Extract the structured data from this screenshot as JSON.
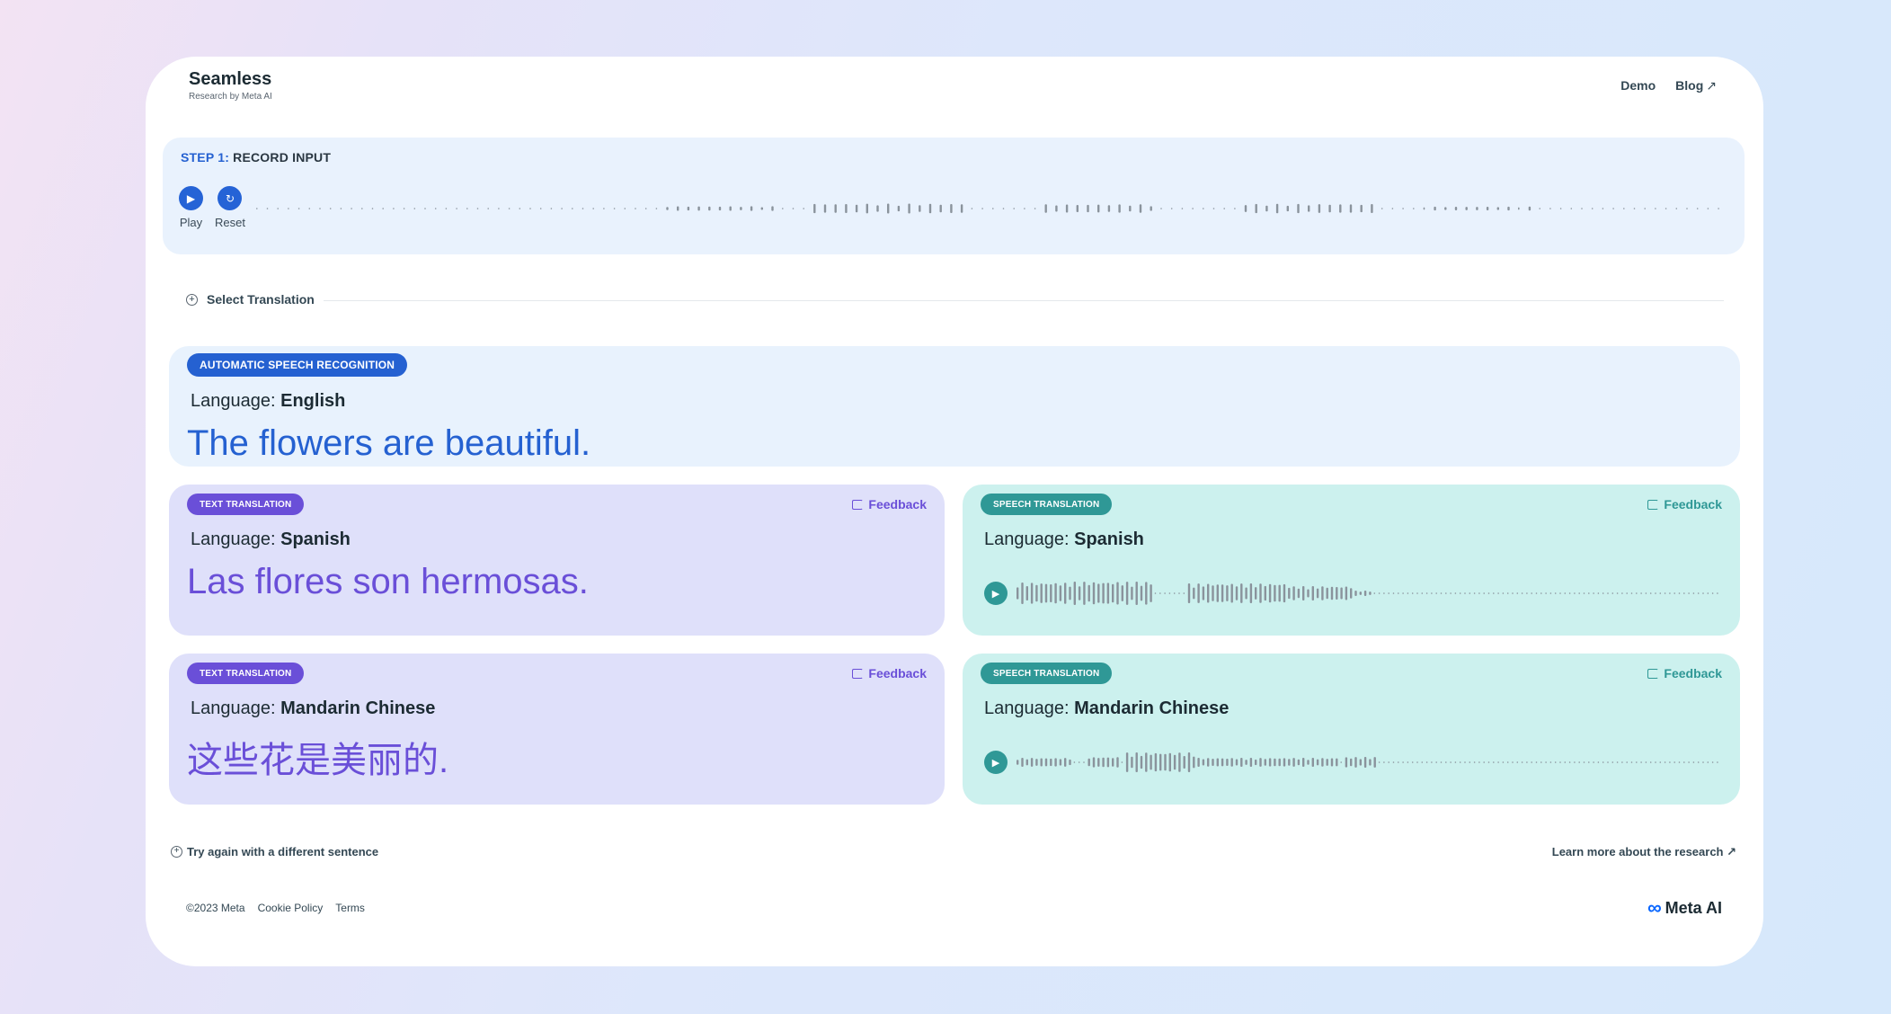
{
  "header": {
    "brand": "Seamless",
    "brand_sub": "Research by Meta AI",
    "nav": [
      {
        "label": "Demo"
      },
      {
        "label": "Blog",
        "icon": "arrow-up-right-icon"
      }
    ]
  },
  "step": {
    "prefix": "STEP 1:",
    "title": " RECORD INPUT",
    "play_label": "Play",
    "reset_label": "Reset"
  },
  "select_translation": "Select Translation",
  "asr": {
    "badge": "AUTOMATIC SPEECH RECOGNITION",
    "lang_prefix": "Language: ",
    "lang": "English",
    "text": "The flowers are beautiful."
  },
  "text_translations": [
    {
      "badge": "TEXT TRANSLATION",
      "lang_prefix": "Language: ",
      "lang": "Spanish",
      "text": "Las flores son hermosas.",
      "feedback": "Feedback"
    },
    {
      "badge": "TEXT TRANSLATION",
      "lang_prefix": "Language: ",
      "lang": "Mandarin Chinese",
      "text": "这些花是美丽的.",
      "feedback": "Feedback"
    }
  ],
  "speech_translations": [
    {
      "badge": "SPEECH TRANSLATION",
      "lang_prefix": "Language: ",
      "lang": "Spanish",
      "feedback": "Feedback"
    },
    {
      "badge": "SPEECH TRANSLATION",
      "lang_prefix": "Language: ",
      "lang": "Mandarin Chinese",
      "feedback": "Feedback"
    }
  ],
  "footer": {
    "try_again": "Try again with a different sentence",
    "learn_more": "Learn more about the research ↗",
    "copyright": "©2023 Meta",
    "cookie": "Cookie Policy",
    "terms": "Terms",
    "logo": "Meta AI"
  },
  "colors": {
    "primary_blue": "#2561d1",
    "purple": "#6a4fd8",
    "teal": "#2f9896"
  }
}
